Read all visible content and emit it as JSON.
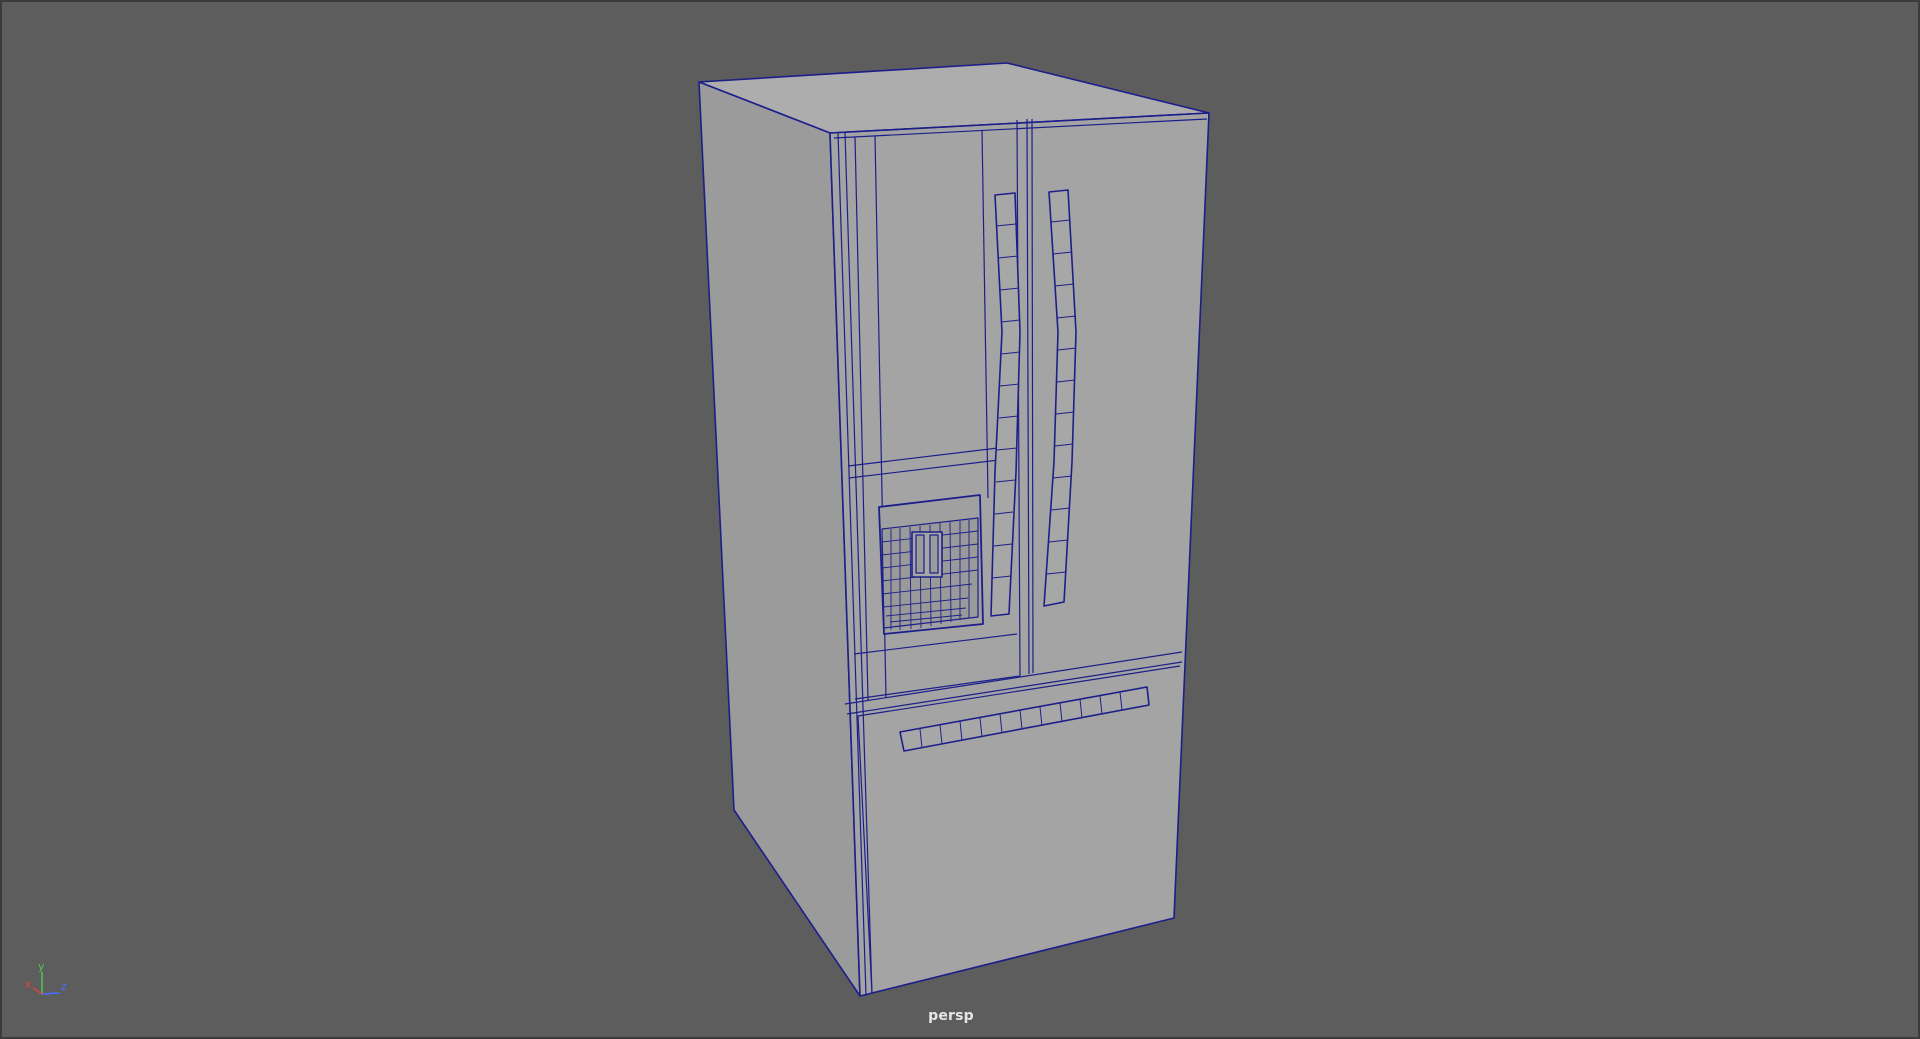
{
  "viewport": {
    "camera_name": "persp",
    "background_color": "#5d5d5d",
    "wireframe_color": "#1c1f8a",
    "mesh_shade": "#a3a3a3"
  },
  "axis_gizmo": {
    "x_label": "x",
    "y_label": "y",
    "z_label": "z",
    "x_color": "#e04040",
    "y_color": "#4fc84f",
    "z_color": "#4a6fff"
  }
}
